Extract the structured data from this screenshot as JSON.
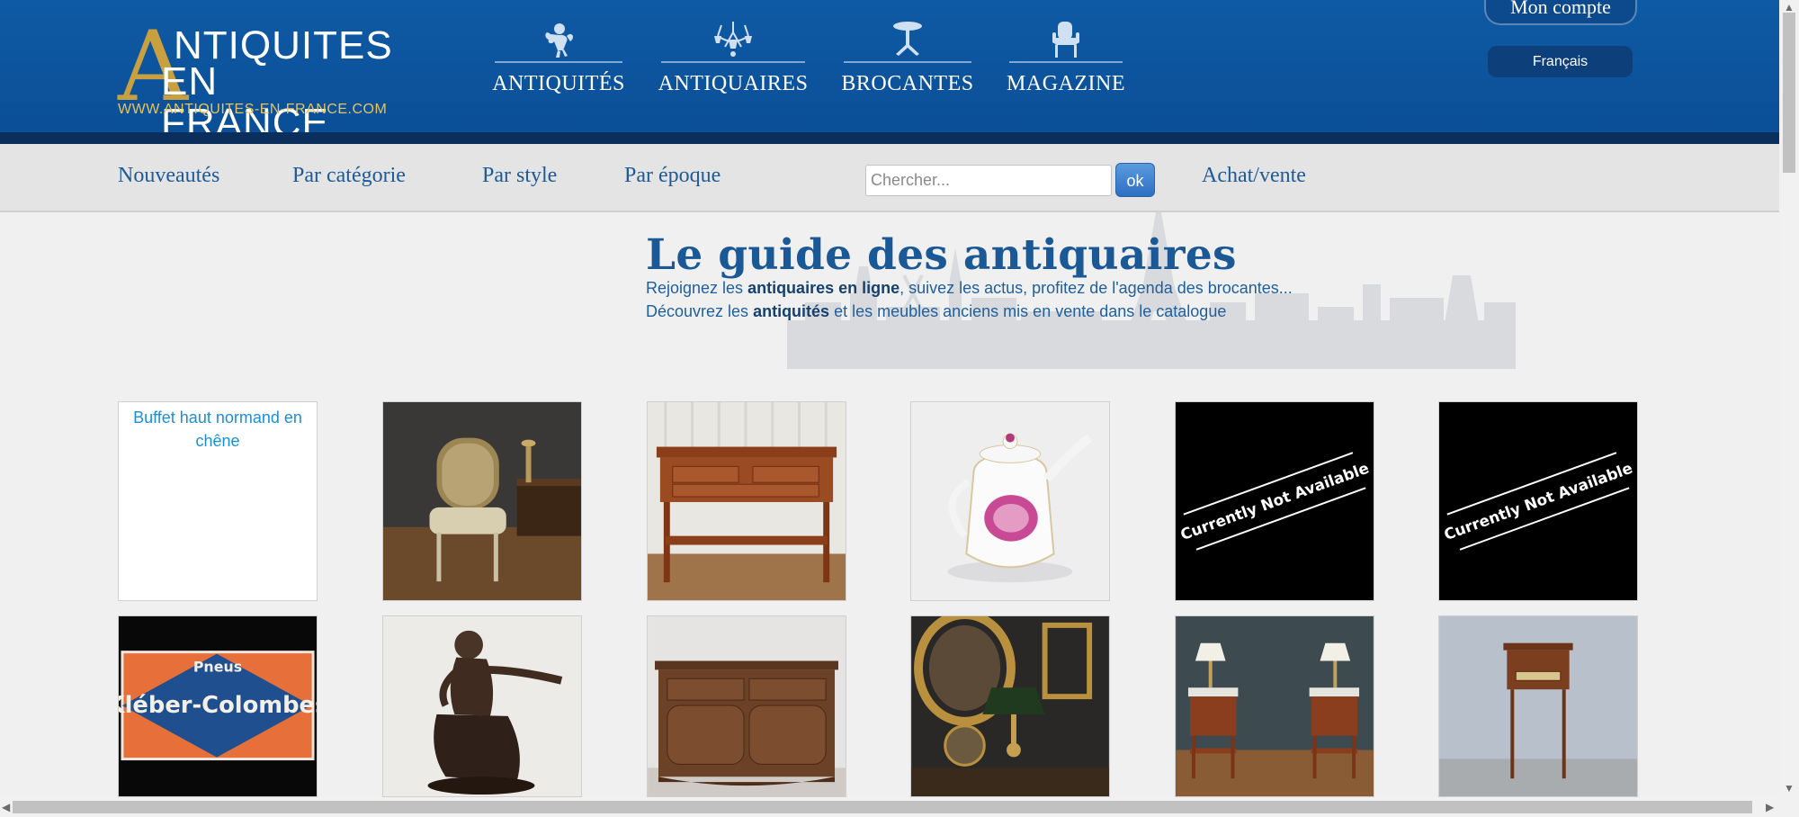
{
  "header": {
    "logo": {
      "big_letter": "A",
      "line1": "NTIQUITES",
      "line2": "EN FRANCE",
      "url": "WWW.ANTIQUITES-EN-FRANCE.COM"
    },
    "main_nav": [
      {
        "label": "ANTIQUITÉS",
        "icon": "cherub-icon"
      },
      {
        "label": "ANTIQUAIRES",
        "icon": "chandelier-icon"
      },
      {
        "label": "BROCANTES",
        "icon": "gueridon-table-icon"
      },
      {
        "label": "MAGAZINE",
        "icon": "armchair-icon"
      }
    ],
    "account_label": "Mon compte",
    "language_label": "Français"
  },
  "subnav": {
    "links": [
      "Nouveautés",
      "Par catégorie",
      "Par style",
      "Par époque",
      "Achat/vente"
    ],
    "search_placeholder": "Chercher...",
    "search_button": "ok"
  },
  "hero": {
    "title": "Le guide des antiquaires",
    "line1": {
      "before": "Rejoignez les ",
      "bold": "antiquaires en ligne",
      "after": ", suivez les actus, profitez de l'agenda des brocantes..."
    },
    "line2": {
      "before": "Découvrez les ",
      "bold": "antiquités",
      "after": " et les meubles anciens mis en vente dans le catalogue"
    }
  },
  "products": [
    {
      "kind": "broken",
      "alt": "Buffet haut normand en chêne"
    },
    {
      "kind": "photo",
      "subject": "cane-armchair"
    },
    {
      "kind": "photo",
      "subject": "mahogany-console-table"
    },
    {
      "kind": "photo",
      "subject": "porcelain-coffee-pot"
    },
    {
      "kind": "unavailable",
      "text": "Currently Not Available"
    },
    {
      "kind": "unavailable",
      "text": "Currently Not Available"
    },
    {
      "kind": "sign",
      "line1": "Pneus",
      "line2": "Kléber-Colombes"
    },
    {
      "kind": "photo",
      "subject": "bronze-sculpture"
    },
    {
      "kind": "photo",
      "subject": "carved-sideboard"
    },
    {
      "kind": "photo",
      "subject": "bouillotte-lamp-and-portrait"
    },
    {
      "kind": "photo",
      "subject": "pair-of-bedside-tables"
    },
    {
      "kind": "photo",
      "subject": "writing-table"
    }
  ],
  "colors": {
    "header_blue": "#0f5aa4",
    "gold": "#c8a040",
    "link_blue": "#1d5a97"
  }
}
